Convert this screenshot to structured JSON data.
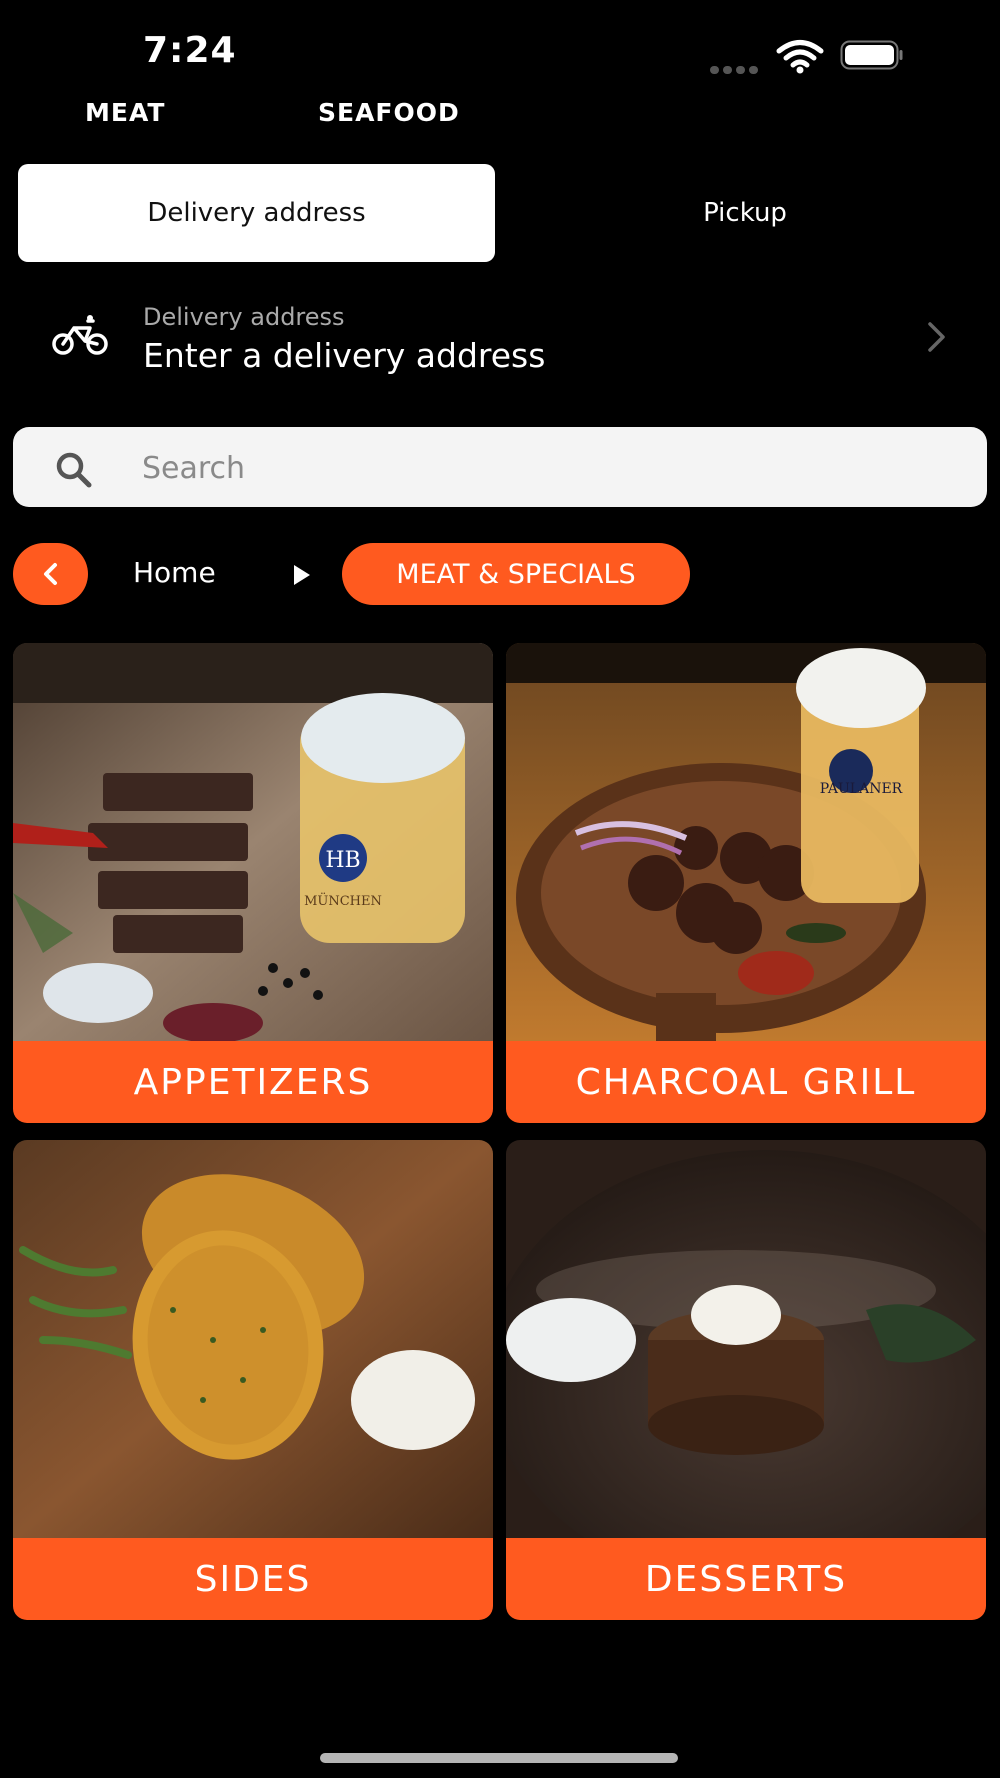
{
  "status_bar": {
    "time": "7:24"
  },
  "top_tabs": [
    {
      "label": "MEAT"
    },
    {
      "label": "SEAFOOD"
    }
  ],
  "mode_toggle": {
    "delivery_label": "Delivery address",
    "pickup_label": "Pickup",
    "selected": "Delivery address"
  },
  "delivery": {
    "label": "Delivery address",
    "value": "Enter a delivery address"
  },
  "search": {
    "placeholder": "Search"
  },
  "breadcrumb": {
    "home": "Home",
    "current": "MEAT & SPECIALS"
  },
  "categories": [
    {
      "label": "APPETIZERS"
    },
    {
      "label": "CHARCOAL GRILL"
    },
    {
      "label": "SIDES"
    },
    {
      "label": "DESSERTS"
    }
  ],
  "colors": {
    "accent": "#ff5a1f",
    "background": "#000000",
    "search_bg": "#f4f4f4"
  },
  "photo_text": {
    "beer_logo_1": "HB",
    "beer_text_1": "MÜNCHEN",
    "beer_text_2": "PAULANER"
  }
}
